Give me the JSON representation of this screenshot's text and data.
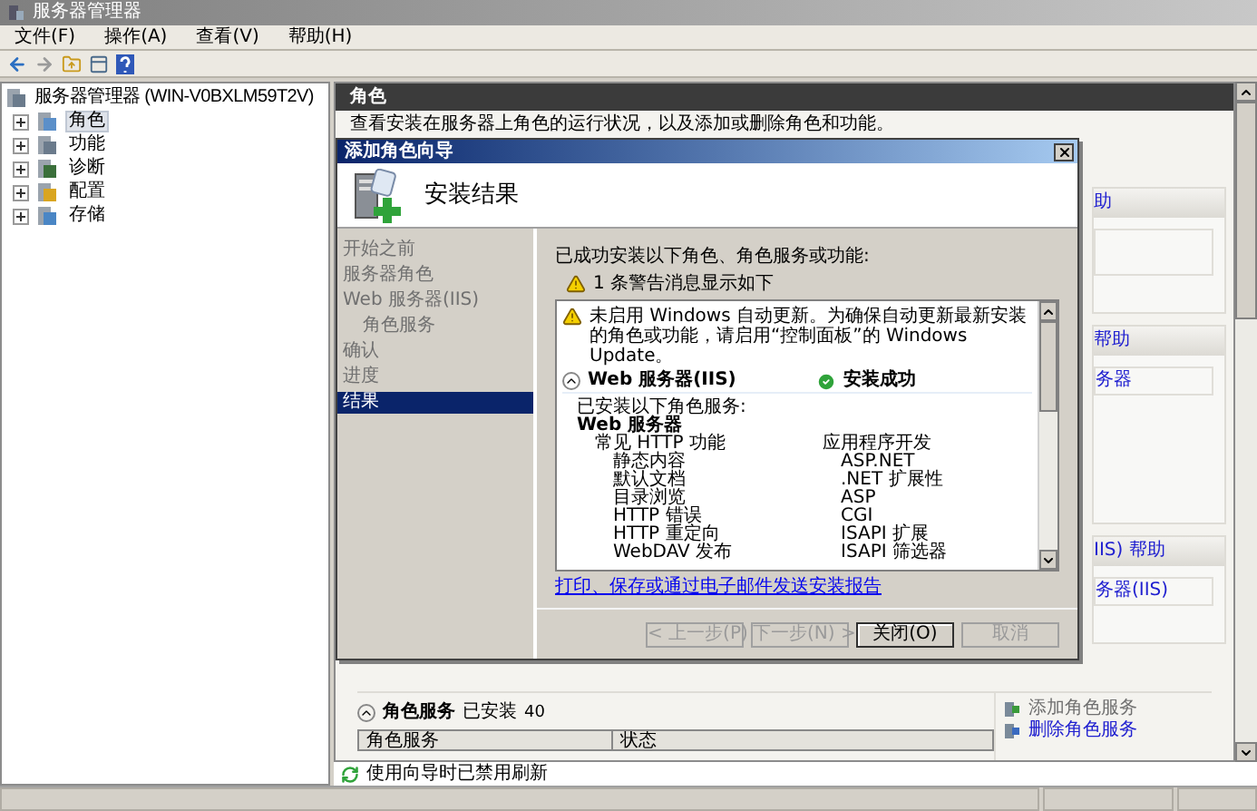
{
  "window": {
    "title": "服务器管理器"
  },
  "menu": [
    "文件(F)",
    "操作(A)",
    "查看(V)",
    "帮助(H)"
  ],
  "tree": {
    "root": "服务器管理器 (WIN-V0BXLM59T2V)",
    "items": [
      {
        "label": "角色",
        "selected": true
      },
      {
        "label": "功能",
        "selected": false
      },
      {
        "label": "诊断",
        "selected": false
      },
      {
        "label": "配置",
        "selected": false
      },
      {
        "label": "存储",
        "selected": false
      }
    ]
  },
  "pane": {
    "title": "角色",
    "description": "查看安装在服务器上角色的运行状况，以及添加或删除角色和功能。",
    "side_sections": [
      {
        "header": "助"
      },
      {
        "header": "帮助",
        "link": "务器"
      },
      {
        "header": "IIS) 帮助",
        "link": "务器(IIS)"
      }
    ],
    "role_services": {
      "heading": "角色服务",
      "status": "已安装",
      "count": "40",
      "columns": [
        "角色服务",
        "状态"
      ],
      "actions": [
        {
          "label": "添加角色服务",
          "disabled": true
        },
        {
          "label": "删除角色服务",
          "disabled": false
        }
      ]
    }
  },
  "status_line": "使用向导时已禁用刷新",
  "dialog": {
    "title": "添加角色向导",
    "heading": "安装结果",
    "steps": [
      {
        "label": "开始之前",
        "selected": false
      },
      {
        "label": "服务器角色",
        "selected": false
      },
      {
        "label": "Web 服务器(IIS)",
        "selected": false,
        "children": [
          {
            "label": "角色服务",
            "selected": false
          }
        ]
      },
      {
        "label": "确认",
        "selected": false
      },
      {
        "label": "进度",
        "selected": false
      },
      {
        "label": "结果",
        "selected": true
      }
    ],
    "intro": "已成功安装以下角色、角色服务或功能:",
    "warning_summary": "1 条警告消息显示如下",
    "warning": "未启用 Windows 自动更新。为确保自动更新最新安装的角色或功能，请启用“控制面板”的 Windows Update。",
    "role": {
      "name": "Web 服务器(IIS)",
      "status": "安装成功"
    },
    "installed_label": "已安装以下角色服务:",
    "installed": [
      {
        "label": "Web 服务器",
        "children": [
          {
            "label": "常见 HTTP 功能",
            "children": [
              {
                "label": "静态内容"
              },
              {
                "label": "默认文档"
              },
              {
                "label": "目录浏览"
              },
              {
                "label": "HTTP 错误"
              },
              {
                "label": "HTTP 重定向"
              },
              {
                "label": "WebDAV 发布"
              }
            ]
          },
          {
            "label": "应用程序开发",
            "children": [
              {
                "label": "ASP.NET"
              },
              {
                "label": ".NET 扩展性"
              },
              {
                "label": "ASP"
              },
              {
                "label": "CGI"
              },
              {
                "label": "ISAPI 扩展"
              },
              {
                "label": "ISAPI 筛选器"
              }
            ]
          }
        ]
      }
    ],
    "report_link": "打印、保存或通过电子邮件发送安装报告",
    "buttons": [
      {
        "label": "< 上一步(P)",
        "disabled": true
      },
      {
        "label": "下一步(N) >",
        "disabled": true
      },
      {
        "label": "关闭(O)",
        "disabled": false
      },
      {
        "label": "取消",
        "disabled": true
      }
    ]
  }
}
